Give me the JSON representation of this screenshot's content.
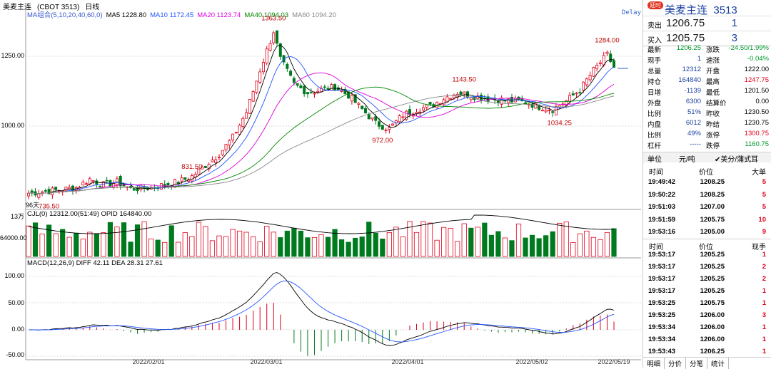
{
  "title": {
    "name": "美麦主连",
    "code": "(CBOT 3513)",
    "period": "日线"
  },
  "delay": "Delay",
  "ma_legend": [
    {
      "text": "MA组合(5,10,20,40,60,0)",
      "color": "#3355cc"
    },
    {
      "text": "MA5 1228.80",
      "color": "#000000"
    },
    {
      "text": "MA10 1172.45",
      "color": "#2255ff"
    },
    {
      "text": "MA20 1123.74",
      "color": "#dd00dd"
    },
    {
      "text": "MA40 1094.03",
      "color": "#008800"
    },
    {
      "text": "MA60 1094.20",
      "color": "#888888"
    }
  ],
  "yaxis_main": [
    "1250.00",
    "1000.00"
  ],
  "yaxis_vol": [
    "13万",
    "64000.00"
  ],
  "yaxis_macd": [
    "100.00",
    "50.00",
    "0.00",
    "-50.00"
  ],
  "price_labels": {
    "high1": "1363.50",
    "high2": "1284.00",
    "high3": "1143.50",
    "high4": "831.50",
    "low1": "735.50",
    "low2": "972.00",
    "low3": "1034.25"
  },
  "days_label": "96天",
  "vol_legend": "CJL(0)    12312.00(51:49)  OPID 164840.00",
  "macd_legend": "MACD(12,26,9)  DIFF 42.11  DEA 28.31   27.61",
  "xaxis": [
    "2022/02/01",
    "2022/03/01",
    "2022/04/01",
    "2022/05/02",
    "2022/05/19"
  ],
  "colors": {
    "up": "#e0001b",
    "down": "#007a1f",
    "dif": "#000000",
    "dea": "#2255ff"
  },
  "panel": {
    "badge": "延时",
    "name": "美麦主连",
    "code": "3513",
    "ask_label": "卖出",
    "ask": "1206.75",
    "ask_vol": "1",
    "bid_label": "买入",
    "bid": "1205.75",
    "bid_vol": "3",
    "stats": [
      {
        "a": "最新",
        "b": "1206.25",
        "c": "涨跌",
        "d": "-24.50/1.99%"
      },
      {
        "a": "现手",
        "b": "1",
        "c": "速涨",
        "d": "-0.04%"
      },
      {
        "a": "总量",
        "b": "12312",
        "c": "开盘",
        "d": "1222.00"
      },
      {
        "a": "持仓",
        "b": "164840",
        "c": "最高",
        "d": "1247.75"
      },
      {
        "a": "日增",
        "b": "-1139",
        "c": "最低",
        "d": "1201.50"
      },
      {
        "a": "外盘",
        "b": "6300",
        "c": "结算价",
        "d": "0.00"
      },
      {
        "a": "比例",
        "b": "51%",
        "c": "昨收",
        "d": "1230.50"
      },
      {
        "a": "内盘",
        "b": "6012",
        "c": "昨结",
        "d": "1230.75"
      },
      {
        "a": "比例",
        "b": "49%",
        "c": "涨停",
        "d": "1300.75"
      },
      {
        "a": "杠杆",
        "b": "-----",
        "c": "跌停",
        "d": "1160.75"
      }
    ],
    "unit_row": {
      "a": "单位",
      "b": "元/吨",
      "c": "美分/蒲式耳"
    },
    "t1_header": {
      "t": "时间",
      "p": "价位",
      "q": "大单"
    },
    "big": [
      {
        "t": "19:49:42",
        "p": "1208.25",
        "q": "5"
      },
      {
        "t": "19:50:22",
        "p": "1208.25",
        "q": "5"
      },
      {
        "t": "19:51:03",
        "p": "1207.00",
        "q": "5"
      },
      {
        "t": "19:51:59",
        "p": "1205.75",
        "q": "10"
      },
      {
        "t": "19:53:16",
        "p": "1205.00",
        "q": "9"
      }
    ],
    "t2_header": {
      "t": "时间",
      "p": "价位",
      "q": "现手"
    },
    "ticks": [
      {
        "t": "19:53:17",
        "p": "1205.25",
        "q": "1"
      },
      {
        "t": "19:53:17",
        "p": "1205.25",
        "q": "2"
      },
      {
        "t": "19:53:17",
        "p": "1205.25",
        "q": "2"
      },
      {
        "t": "19:53:17",
        "p": "1205.25",
        "q": "1"
      },
      {
        "t": "19:53:25",
        "p": "1205.75",
        "q": "1"
      },
      {
        "t": "19:53:25",
        "p": "1206.00",
        "q": "3"
      },
      {
        "t": "19:53:34",
        "p": "1206.00",
        "q": "1"
      },
      {
        "t": "19:53:34",
        "p": "1206.00",
        "q": "1"
      },
      {
        "t": "19:53:43",
        "p": "1206.25",
        "q": "1"
      }
    ],
    "tabs": [
      "明细",
      "分价",
      "分笔",
      "统计"
    ]
  }
}
